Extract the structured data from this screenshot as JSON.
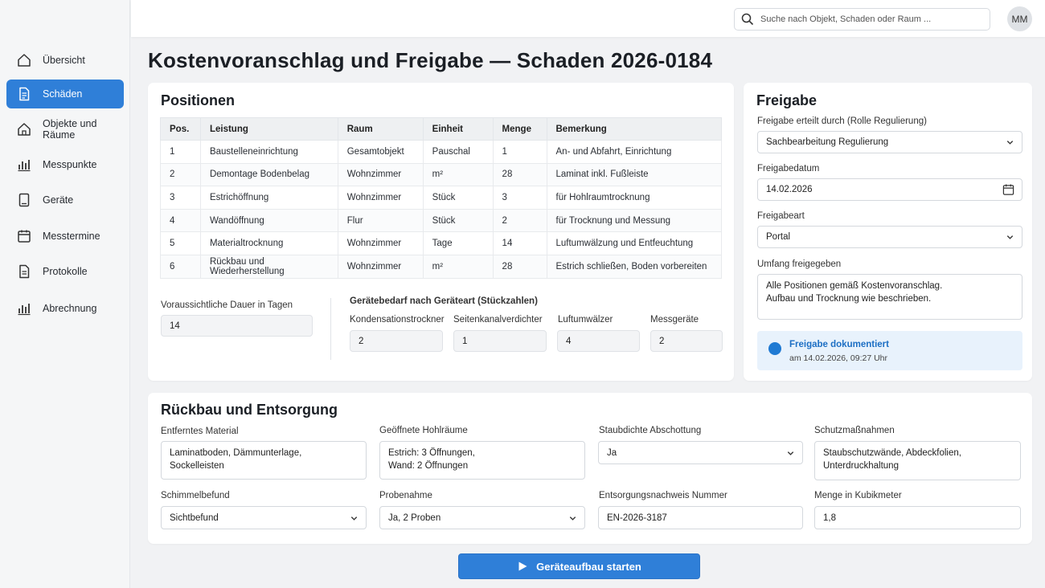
{
  "nav": {
    "items": [
      {
        "label": "Übersicht",
        "icon": "home-icon"
      },
      {
        "label": "Schäden",
        "icon": "document-icon"
      },
      {
        "label": "Objekte und Räume",
        "icon": "building-icon"
      },
      {
        "label": "Messpunkte",
        "icon": "bar-chart-icon"
      },
      {
        "label": "Geräte",
        "icon": "device-icon"
      },
      {
        "label": "Messtermine",
        "icon": "calendar-icon"
      },
      {
        "label": "Protokolle",
        "icon": "file-icon"
      },
      {
        "label": "Abrechnung",
        "icon": "bar-chart-icon"
      }
    ],
    "active_index": 1
  },
  "topbar": {
    "search_placeholder": "Suche nach Objekt, Schaden oder Raum ...",
    "avatar_initials": "MM"
  },
  "page": {
    "title": "Kostenvoranschlag und Freigabe — Schaden 2026-0184"
  },
  "positions": {
    "title": "Positionen",
    "columns": [
      "Pos.",
      "Leistung",
      "Raum",
      "Einheit",
      "Menge",
      "Bemerkung"
    ],
    "rows": [
      [
        "1",
        "Baustelleneinrichtung",
        "Gesamtobjekt",
        "Pauschal",
        "1",
        "An- und Abfahrt, Einrichtung"
      ],
      [
        "2",
        "Demontage Bodenbelag",
        "Wohnzimmer",
        "m²",
        "28",
        "Laminat inkl. Fußleiste"
      ],
      [
        "3",
        "Estrichöffnung",
        "Wohnzimmer",
        "Stück",
        "3",
        "für Hohlraumtrocknung"
      ],
      [
        "4",
        "Wandöffnung",
        "Flur",
        "Stück",
        "2",
        "für Trocknung und Messung"
      ],
      [
        "5",
        "Materialtrocknung",
        "Wohnzimmer",
        "Tage",
        "14",
        "Luftumwälzung und Entfeuchtung"
      ],
      [
        "6",
        "Rückbau und Wiederherstellung",
        "Wohnzimmer",
        "m²",
        "28",
        "Estrich schließen, Boden vorbereiten"
      ]
    ],
    "duration_label": "Voraussichtliche Dauer in Tagen",
    "duration_value": "14",
    "devices_heading": "Gerätebedarf nach Geräteart (Stückzahlen)",
    "devices": [
      {
        "label": "Kondensationstrockner",
        "value": "2"
      },
      {
        "label": "Seitenkanalverdichter",
        "value": "1"
      },
      {
        "label": "Luftumwälzer",
        "value": "4"
      },
      {
        "label": "Messgeräte",
        "value": "2"
      }
    ]
  },
  "approval": {
    "title": "Freigabe",
    "approved_by_label": "Freigabe erteilt durch (Rolle Regulierung)",
    "approved_by_value": "Sachbearbeitung Regulierung",
    "date_label": "Freigabedatum",
    "date_value": "14.02.2026",
    "type_label": "Freigabeart",
    "type_value": "Portal",
    "scope_label": "Umfang freigegeben",
    "scope_value": "Alle Positionen gemäß Kostenvoranschlag.\nAufbau und Trocknung wie beschrieben.",
    "notice_title": "Freigabe dokumentiert",
    "notice_sub": "am 14.02.2026, 09:27 Uhr",
    "notice_color": "#1f7ad3"
  },
  "disposal": {
    "title": "Rückbau und Entsorgung",
    "removed_label": "Entferntes Material",
    "removed_value": "Laminatboden, Dämmunterlage,\nSockelleisten",
    "cavities_label": "Geöffnete Hohlräume",
    "cavities_value": "Estrich: 3 Öffnungen,\nWand: 2 Öffnungen",
    "dust_label": "Staubdichte Abschottung",
    "dust_value": "Ja",
    "protect_label": "Schutzmaßnahmen",
    "protect_value": "Staubschutzwände, Abdeckfolien,\nUnterdruckhaltung",
    "mold_label": "Schimmelbefund",
    "mold_value": "Sichtbefund",
    "sample_label": "Probenahme",
    "sample_value": "Ja, 2 Proben",
    "proof_label": "Entsorgungsnachweis Nummer",
    "proof_value": "EN-2026-3187",
    "volume_label": "Menge in Kubikmeter",
    "volume_value": "1,8"
  },
  "actions": {
    "start_label": "Geräteaufbau starten",
    "accent": "#2f7fd8"
  }
}
